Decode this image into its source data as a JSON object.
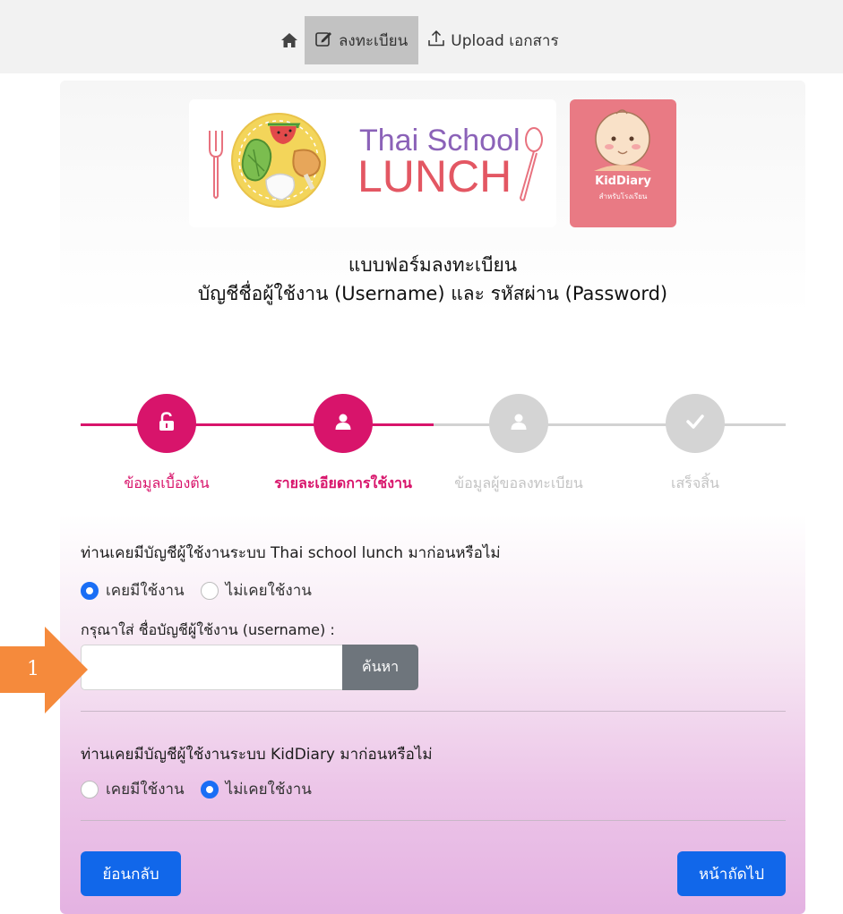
{
  "nav": {
    "register_label": "ลงทะเบียน",
    "upload_label": "Upload เอกสาร",
    "home_icon": "home-icon",
    "edit_icon": "edit-icon",
    "upload_icon": "upload-icon"
  },
  "logos": {
    "thai_school_line1": "Thai School",
    "thai_school_line2": "LUNCH",
    "kiddiary_name": "KidDiary",
    "kiddiary_sub": "สำหรับโรงเรียน"
  },
  "form": {
    "title_line1": "แบบฟอร์มลงทะเบียน",
    "title_line2": "บัญชีชื่อผู้ใช้งาน (Username) และ รหัสผ่าน (Password)"
  },
  "steps": [
    {
      "label": "ข้อมูลเบื้องต้น",
      "icon": "unlock-icon",
      "state": "active"
    },
    {
      "label": "รายละเอียดการใช้งาน",
      "icon": "user-icon",
      "state": "active"
    },
    {
      "label": "ข้อมูลผู้ขอลงทะเบียน",
      "icon": "user-icon",
      "state": "inactive"
    },
    {
      "label": "เสร็จสิ้น",
      "icon": "check-icon",
      "state": "inactive"
    }
  ],
  "tsl_section": {
    "question": "ท่านเคยมีบัญชีผู้ใช้งานระบบ Thai school lunch มาก่อนหรือไม่",
    "option_yes": "เคยมีใช้งาน",
    "option_no": "ไม่เคยใช้งาน",
    "selected": "yes",
    "username_label": "กรุณาใส่ ชื่อบัญชีผู้ใช้งาน (username) :",
    "username_value": "",
    "search_label": "ค้นหา"
  },
  "kd_section": {
    "question": "ท่านเคยมีบัญชีผู้ใช้งานระบบ KidDiary มาก่อนหรือไม่",
    "option_yes": "เคยมีใช้งาน",
    "option_no": "ไม่เคยใช้งาน",
    "selected": "no"
  },
  "buttons": {
    "back_label": "ย้อนกลับ",
    "next_label": "หน้าถัดไป"
  },
  "annotation": {
    "number": "1",
    "color": "#f58a3c"
  },
  "colors": {
    "accent": "#d8146b",
    "inactive": "#d4d4d4",
    "primary": "#1167ea"
  }
}
